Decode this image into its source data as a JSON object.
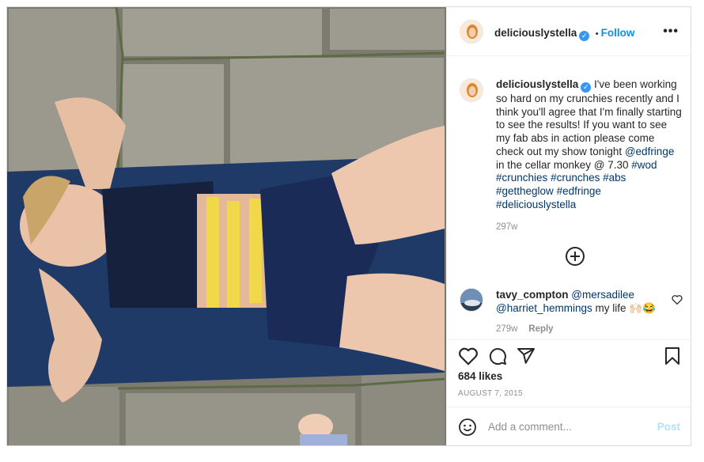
{
  "post": {
    "username": "deliciouslystella",
    "verified_mark": "✓",
    "separator": "•",
    "follow_label": "Follow",
    "more_label": "•••",
    "caption": {
      "username": "deliciouslystella",
      "text": " I've been working so hard on my crunchies recently and I think you'll agree that I'm finally starting to see the results! If you want to see my fab abs in action please come check out my show tonight ",
      "mention": "@edfringe",
      "text2": " in the cellar monkey @ 7.30 ",
      "hashtags": [
        "#wod",
        "#crunchies",
        "#crunches",
        "#abs",
        "#gettheglow",
        "#edfringe",
        "#deliciouslystella"
      ],
      "age": "297w"
    },
    "load_more_icon": "plus-circle-icon",
    "comment": {
      "username": "tavy_compton",
      "mention1": "@mersadilee",
      "mention2": "@harriet_hemmings",
      "text": " my life 🙌🏻😂",
      "age": "279w",
      "reply_label": "Reply"
    },
    "actions": [
      "heart-icon",
      "comment-icon",
      "share-icon",
      "bookmark-icon"
    ],
    "likes": "684 likes",
    "date": "AUGUST 7, 2015",
    "add_comment_placeholder": "Add a comment...",
    "post_button": "Post",
    "colors": {
      "accent": "#0095f6",
      "text": "#262626",
      "muted": "#8e8e8e",
      "hashtag": "#00376b",
      "mat": "#1f3a66"
    }
  }
}
